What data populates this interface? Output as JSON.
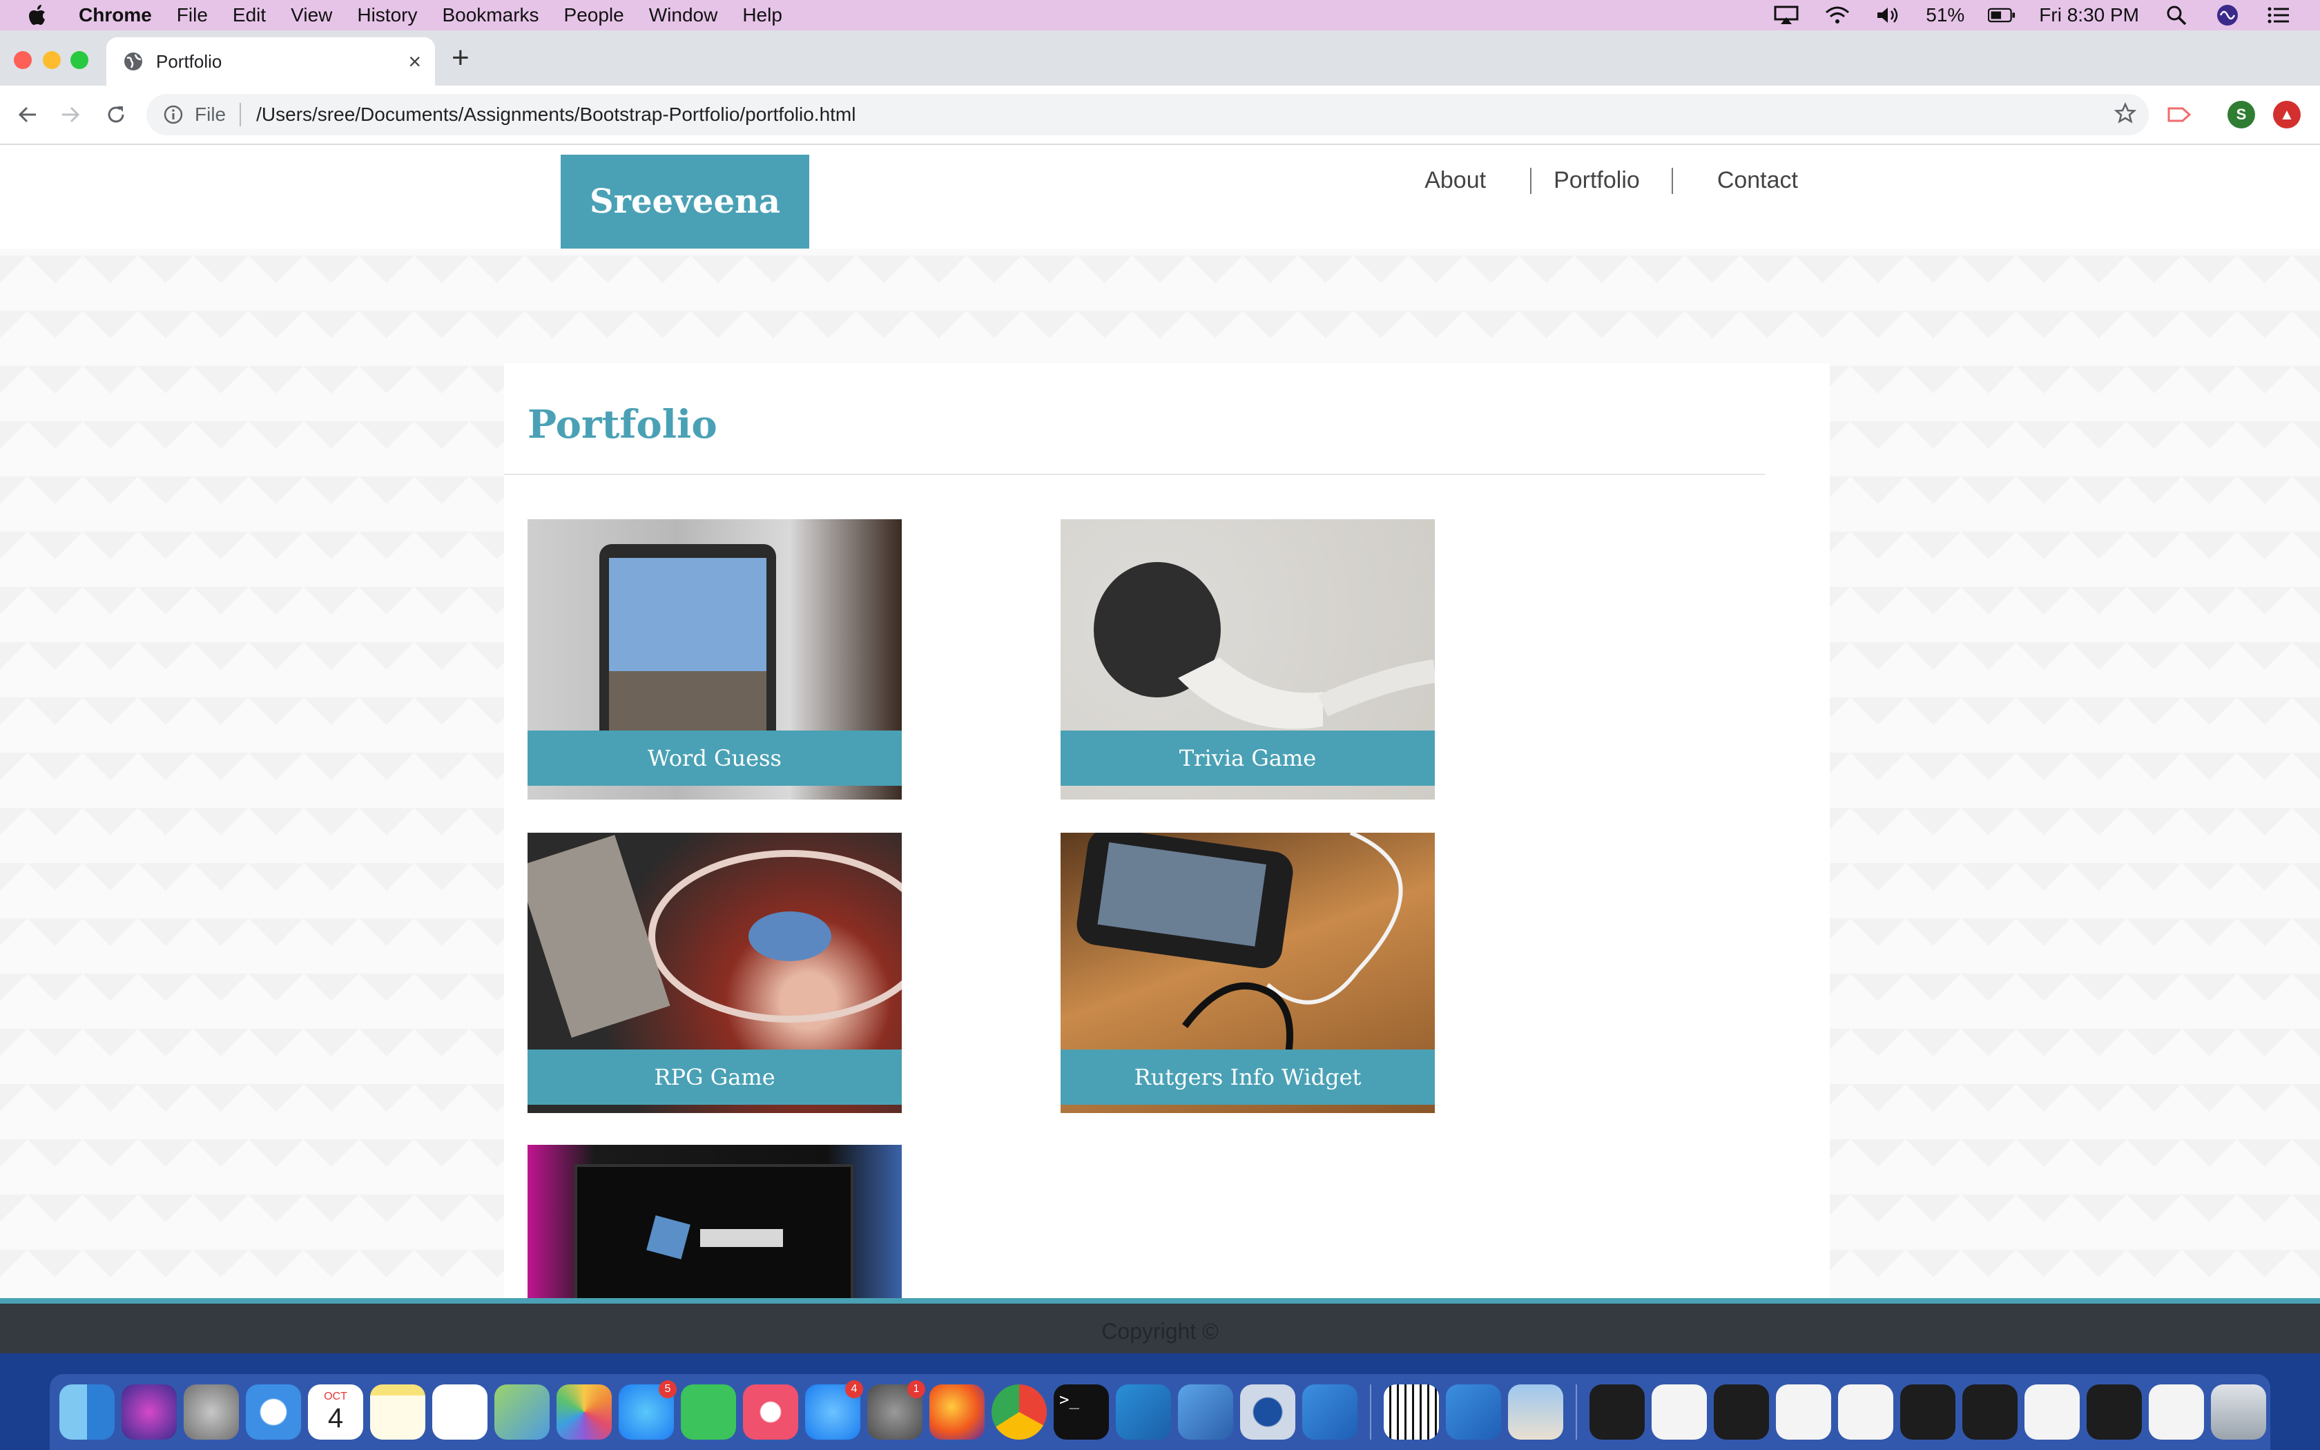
{
  "menubar": {
    "app_name": "Chrome",
    "items": [
      "File",
      "Edit",
      "View",
      "History",
      "Bookmarks",
      "People",
      "Window",
      "Help"
    ],
    "battery": "51%",
    "clock": "Fri 8:30 PM"
  },
  "browser": {
    "tab_title": "Portfolio",
    "scheme_label": "File",
    "url": "/Users/sree/Documents/Assignments/Bootstrap-Portfolio/portfolio.html",
    "profile_initial": "S"
  },
  "site": {
    "brand": "Sreeveena",
    "nav": [
      "About",
      "Portfolio",
      "Contact"
    ],
    "page_title": "Portfolio",
    "projects": [
      "Word Guess",
      "Trivia Game",
      "RPG Game",
      "Rutgers Info Widget"
    ],
    "footer": "Copyright ©"
  },
  "dock": {
    "badges": {
      "messages": "5",
      "app_store": "4",
      "system_prefs": "1"
    },
    "calendar_month": "OCT",
    "calendar_day": "4"
  },
  "colors": {
    "accent": "#4aa1b5",
    "footer_bg": "#343a40",
    "menubar_bg": "#e6c4e8"
  }
}
